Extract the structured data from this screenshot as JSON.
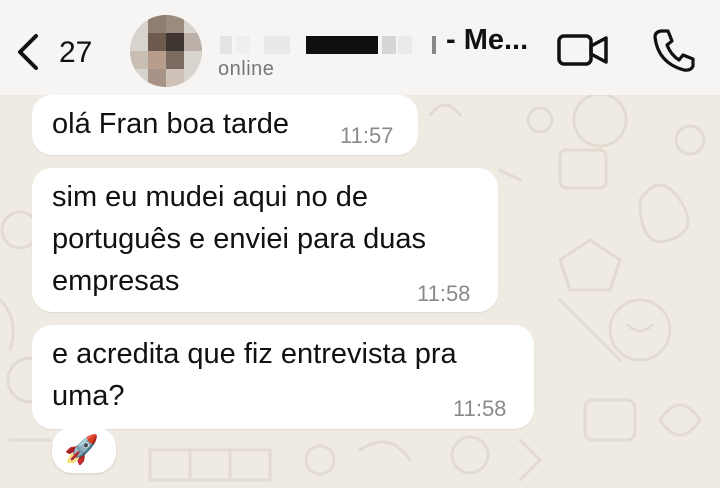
{
  "header": {
    "back_count": "27",
    "contact_name": "- Me...",
    "status": "online",
    "icons": {
      "back": "chevron-left-icon",
      "video": "video-camera-icon",
      "call": "phone-icon"
    }
  },
  "messages": [
    {
      "text": "olá Fran boa tarde",
      "time": "11:57"
    },
    {
      "text": "sim eu mudei aqui no de\nportuguês e enviei para duas\nempresas",
      "time": "11:58"
    },
    {
      "text": "e acredita que fiz entrevista pra\numa?",
      "time": "11:58"
    }
  ],
  "reaction": {
    "emoji": "🚀"
  },
  "colors": {
    "background": "#efeae2",
    "bubble": "#ffffff",
    "header": "#f6f5f3",
    "time": "#8a8a8a"
  }
}
